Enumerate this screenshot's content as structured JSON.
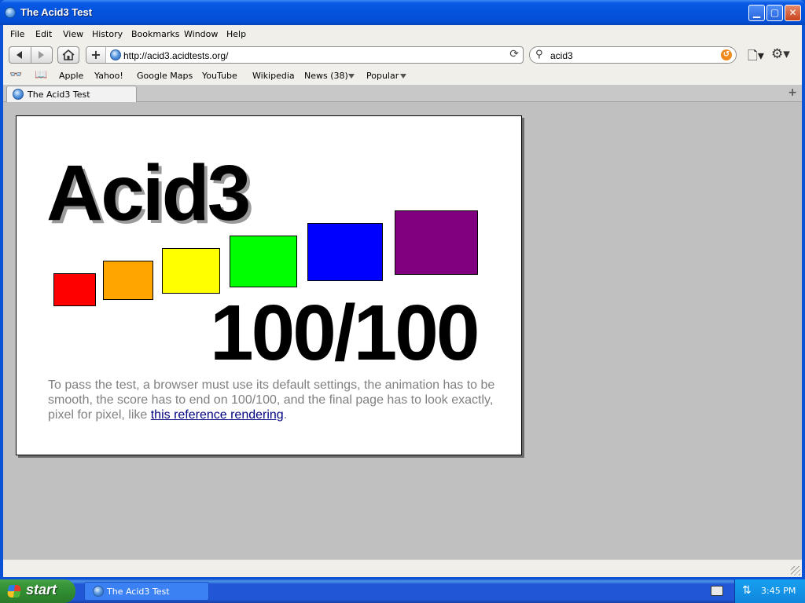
{
  "window": {
    "title": "The Acid3 Test",
    "controls": {
      "minimize": "▁",
      "maximize": "▢",
      "close": "✕"
    }
  },
  "menu": {
    "items": [
      "File",
      "Edit",
      "View",
      "History",
      "Bookmarks",
      "Window",
      "Help"
    ]
  },
  "toolbar": {
    "url": "http://acid3.acidtests.org/",
    "search_value": "acid3",
    "add_label": "+"
  },
  "bookmarks": {
    "items": [
      "Apple",
      "Yahoo!",
      "Google Maps",
      "YouTube",
      "Wikipedia",
      "News (38)",
      "Popular"
    ]
  },
  "tabs": [
    {
      "label": "The Acid3 Test",
      "active": true
    }
  ],
  "page": {
    "heading": "Acid3",
    "score": "100/100",
    "description_prefix": "To pass the test, a browser must use its default settings, the animation has to be smooth, the score has to end on 100/100, and the final page has to look exactly, pixel for pixel, like ",
    "link_text": "this reference rendering",
    "description_suffix": ".",
    "bucket_colors": [
      "#ff0000",
      "#ffa500",
      "#ffff00",
      "#00ff00",
      "#0000ff",
      "#800080"
    ]
  },
  "taskbar": {
    "start_label": "start",
    "task_label": "The Acid3 Test",
    "clock": "3:45 PM"
  },
  "colors": {
    "titlebar": "#0453dd",
    "chrome": "#f0efe9",
    "content_bg": "#c0c0c0",
    "link": "#000080",
    "description": "#808080"
  }
}
